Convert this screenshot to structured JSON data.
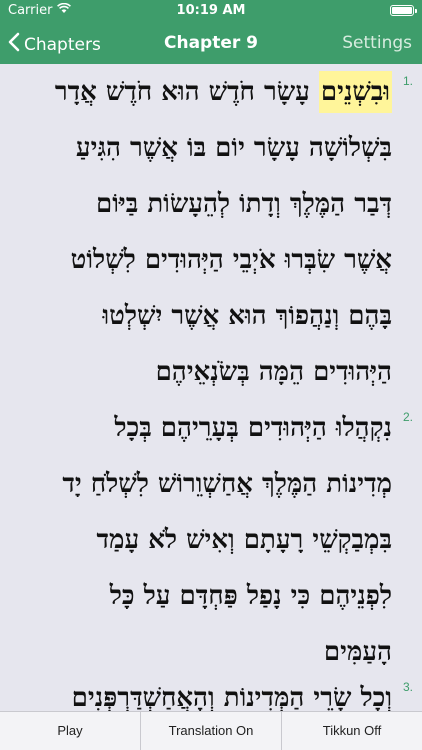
{
  "status": {
    "carrier": "Carrier",
    "time": "10:19 AM"
  },
  "nav": {
    "back_label": "Chapters",
    "title": "Chapter 9",
    "settings_label": "Settings"
  },
  "verses": [
    {
      "num": "1.",
      "lines": [
        [
          "וּבִשְׁנֵים",
          " עָשָׂר חֹדֶשׁ הוּא חֹדֶשׁ אֲדָר"
        ],
        [
          "",
          "בִּשְׁלוֹשָׁה עָשָׂר יוֹם בּוֹ אֲשֶׁר הִגִּיעַ"
        ],
        [
          "",
          "דְּבַר הַמֶּלֶךְ וְדָתוֹ לְהֵעָשׂוֹת בַּיּוֹם"
        ],
        [
          "",
          "אֲשֶׁר שִׂבְּרוּ אֹיְבֵי הַיְּהוּדִים לִשְׁלוֹט"
        ],
        [
          "",
          "בָּהֶם וְנַהֲפוֹךְ הוּא אֲשֶׁר יִשְׁלְטוּ"
        ],
        [
          "",
          "הַיְּהוּדִים הֵמָּה בְּשֹׂנְאֵיהֶם"
        ]
      ]
    },
    {
      "num": "2.",
      "lines": [
        [
          "",
          "נִקְהֲלוּ הַיְּהוּדִים בְּעָרֵיהֶם בְּכָל"
        ],
        [
          "",
          "מְדִינוֹת הַמֶּלֶךְ אֲחַשְׁוֵרוֹשׁ לִשְׁלֹחַ יָד"
        ],
        [
          "",
          "בִּמְבַקְשֵׁי רָעָתָם וְאִישׁ לֹא עָמַד"
        ],
        [
          "",
          "לִפְנֵיהֶם כִּי נָפַל פַּחְדָּם עַל כָּל"
        ],
        [
          "",
          "הָעַמִּים"
        ]
      ]
    },
    {
      "num": "3.",
      "lines": [
        [
          "",
          "וְכָל שָׂרֵי הַמְּדִינוֹת וְהָאֲחַשְׁדַּרְפְּנִים"
        ]
      ]
    }
  ],
  "toolbar": {
    "play": "Play",
    "translation": "Translation On",
    "tikkun": "Tikkun Off"
  },
  "colors": {
    "header": "#3e9d6b",
    "highlight": "#fff59a",
    "background": "#e6e6ee"
  }
}
